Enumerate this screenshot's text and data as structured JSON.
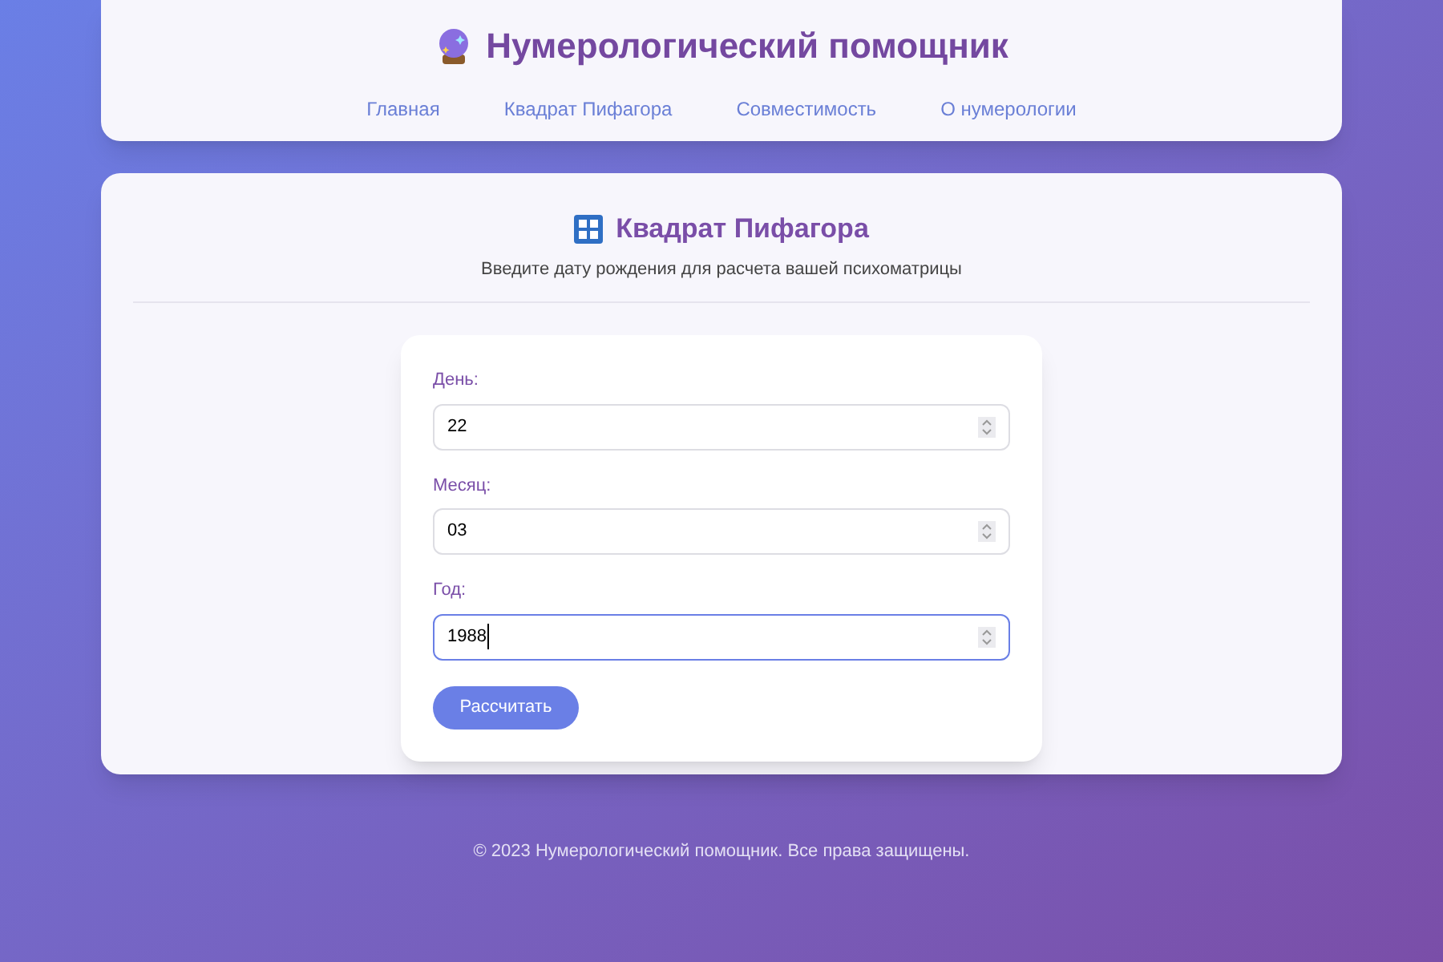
{
  "header": {
    "title": "Нумерологический помощник",
    "nav": [
      {
        "label": "Главная"
      },
      {
        "label": "Квадрат Пифагора"
      },
      {
        "label": "Совместимость"
      },
      {
        "label": "О нумерологии"
      }
    ]
  },
  "section": {
    "title": "Квадрат Пифагора",
    "subtitle": "Введите дату рождения для расчета вашей психоматрицы"
  },
  "form": {
    "fields": [
      {
        "label": "День:",
        "value": "22",
        "focused": false
      },
      {
        "label": "Месяц:",
        "value": "03",
        "focused": false
      },
      {
        "label": "Год:",
        "value": "1988",
        "focused": true
      }
    ],
    "button": "Рассчитать"
  },
  "footer": "© 2023 Нумерологический помощник. Все права защищены."
}
